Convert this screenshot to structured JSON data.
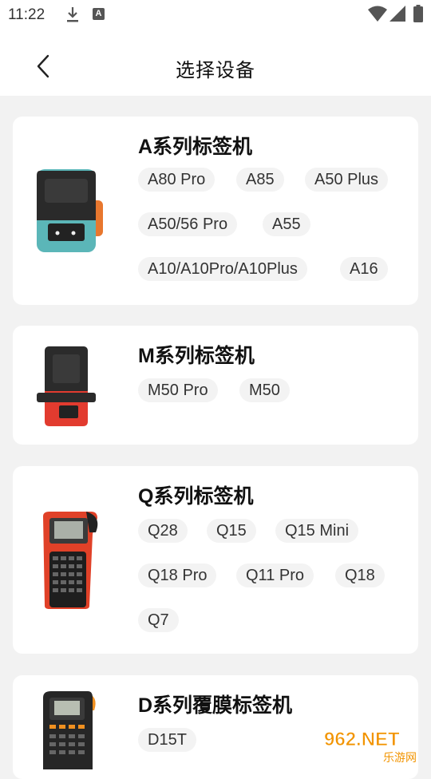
{
  "status_bar": {
    "time": "11:22",
    "a_badge": "A"
  },
  "header": {
    "title": "选择设备"
  },
  "series": [
    {
      "title": "A系列标签机",
      "models": [
        "A80 Pro",
        "A85",
        "A50 Plus",
        "A50/56 Pro",
        "A55",
        "A10/A10Pro/A10Plus",
        "A16"
      ]
    },
    {
      "title": "M系列标签机",
      "models": [
        "M50 Pro",
        "M50"
      ]
    },
    {
      "title": "Q系列标签机",
      "models": [
        "Q28",
        "Q15",
        "Q15 Mini",
        "Q18 Pro",
        "Q11 Pro",
        "Q18",
        "Q7"
      ]
    },
    {
      "title": "D系列覆膜标签机",
      "models": [
        "D15T"
      ]
    }
  ],
  "watermark": {
    "text": "962.NET",
    "subtext": "乐游网"
  },
  "colors": {
    "background": "#f2f2f2",
    "card": "#ffffff",
    "tag_bg": "#f3f3f3",
    "watermark_orange": "#f29400"
  },
  "icons": [
    "download-icon",
    "a-notification-icon",
    "wifi-icon",
    "signal-icon",
    "battery-icon",
    "back-arrow-icon"
  ]
}
